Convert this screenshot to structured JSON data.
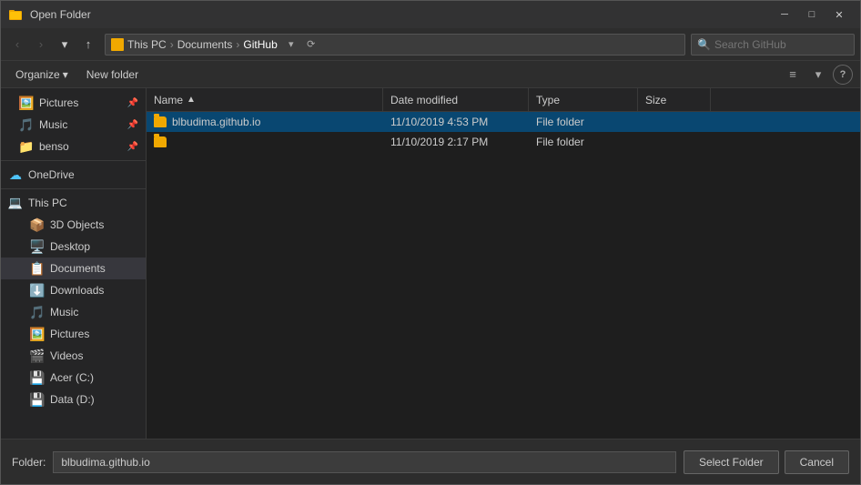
{
  "titleBar": {
    "title": "Open Folder",
    "closeBtn": "✕",
    "icon": "📁"
  },
  "toolbar": {
    "backBtn": "‹",
    "forwardBtn": "›",
    "dropBtn": "▾",
    "upBtn": "↑",
    "addressCrumbs": [
      "This PC",
      "Documents",
      "GitHub"
    ],
    "addressIcon": "",
    "dropdownBtn": "▾",
    "refreshBtn": "⟳",
    "searchPlaceholder": "Search GitHub",
    "searchBtn": "🔍"
  },
  "toolbar2": {
    "organizeLabel": "Organize",
    "newFolderLabel": "New folder",
    "viewBtn": "≡",
    "viewDropBtn": "▾",
    "helpBtn": "?"
  },
  "sidebar": {
    "quickAccess": [
      {
        "label": "Pictures",
        "icon": "🖼️",
        "pinned": true,
        "indent": 1
      },
      {
        "label": "Music",
        "icon": "🎵",
        "pinned": true,
        "indent": 1
      },
      {
        "label": "benso",
        "icon": "📁",
        "pinned": true,
        "indent": 1
      }
    ],
    "oneDrive": {
      "label": "OneDrive",
      "icon": "☁"
    },
    "thisPC": {
      "label": "This PC",
      "icon": "💻"
    },
    "thisPCItems": [
      {
        "label": "3D Objects",
        "icon": "📦",
        "indent": 2
      },
      {
        "label": "Desktop",
        "icon": "🖥️",
        "indent": 2
      },
      {
        "label": "Documents",
        "icon": "📋",
        "indent": 2,
        "selected": true
      },
      {
        "label": "Downloads",
        "icon": "⬇️",
        "indent": 2
      },
      {
        "label": "Music",
        "icon": "🎵",
        "indent": 2
      },
      {
        "label": "Pictures",
        "icon": "🖼️",
        "indent": 2
      },
      {
        "label": "Videos",
        "icon": "🎬",
        "indent": 2
      },
      {
        "label": "Acer (C:)",
        "icon": "💾",
        "indent": 2
      },
      {
        "label": "Data (D:)",
        "icon": "💾",
        "indent": 2
      }
    ]
  },
  "fileList": {
    "columns": [
      {
        "label": "Name",
        "sortIcon": "▲"
      },
      {
        "label": "Date modified"
      },
      {
        "label": "Type"
      },
      {
        "label": "Size"
      }
    ],
    "files": [
      {
        "name": "blbudima.github.io",
        "dateModified": "11/10/2019 4:53 PM",
        "type": "File folder",
        "size": "",
        "selected": true
      },
      {
        "name": "",
        "dateModified": "11/10/2019 2:17 PM",
        "type": "File folder",
        "size": "",
        "selected": false
      }
    ]
  },
  "bottomBar": {
    "folderLabel": "Folder:",
    "folderValue": "blbudima.github.io",
    "selectBtn": "Select Folder",
    "cancelBtn": "Cancel"
  }
}
